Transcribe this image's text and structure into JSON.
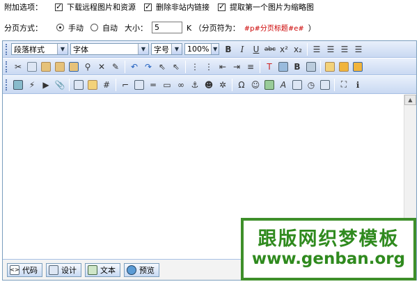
{
  "options": {
    "label": "附加选项：",
    "download_remote": "下载远程图片和资源",
    "remove_links": "删除非站内链接",
    "extract_thumb": "提取第一个图片为缩略图"
  },
  "paging": {
    "label": "分页方式：",
    "manual": "手动",
    "auto": "自动",
    "size_label": "大小：",
    "size_value": "5",
    "unit_text": "K （分页符为：",
    "separator_tag": "#p#分页标题#e#",
    "close_paren": "）"
  },
  "toolbar1": {
    "format_select": "段落样式",
    "font_select": "字体",
    "size_select": "字号",
    "zoom_select": "100%"
  },
  "bottom_tabs": {
    "code": "代码",
    "design": "设计",
    "text": "文本",
    "preview": "预览"
  },
  "watermark": {
    "line1": "跟版网织梦模板",
    "line2": "www.genban.org"
  },
  "colors": {
    "toolbar_top": "#e9f0fb",
    "toolbar_bottom": "#c9d9f2",
    "separator_red": "#cc0000",
    "watermark_green": "#2f8a1e"
  }
}
